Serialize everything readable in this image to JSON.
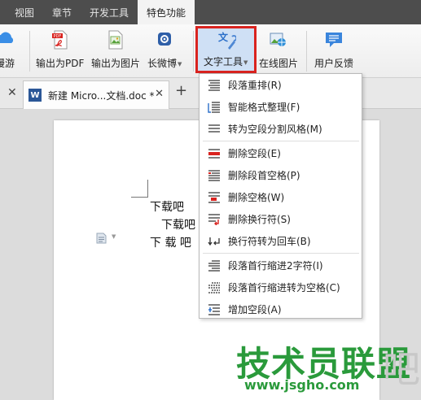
{
  "ribbon": {
    "tabs": [
      "视图",
      "章节",
      "开发工具",
      "特色功能"
    ],
    "active_tab": "特色功能"
  },
  "toolbar": {
    "partial_label": "漫游",
    "export_pdf": "输出为PDF",
    "export_image": "输出为图片",
    "long_weibo": "长微博",
    "text_tools": "文字工具",
    "online_images": "在线图片",
    "feedback": "用户反馈"
  },
  "document_tabs": {
    "title": "新建 Micro...文档.doc *"
  },
  "document": {
    "lines": [
      "下载吧",
      "下载吧",
      "下  载  吧"
    ]
  },
  "menu": {
    "items": [
      {
        "label": "段落重排(R)",
        "icon": "paragraph-reflow-icon"
      },
      {
        "label": "智能格式整理(F)",
        "icon": "smart-format-icon"
      },
      {
        "label": "转为空段分割风格(M)",
        "icon": "blank-split-style-icon"
      },
      {
        "label": "删除空段(E)",
        "icon": "delete-blank-paragraph-icon"
      },
      {
        "label": "删除段首空格(P)",
        "icon": "delete-leading-space-icon"
      },
      {
        "label": "删除空格(W)",
        "icon": "delete-space-icon"
      },
      {
        "label": "删除换行符(S)",
        "icon": "delete-linebreak-icon"
      },
      {
        "label": "换行符转为回车(B)",
        "icon": "linebreak-to-enter-icon"
      },
      {
        "label": "段落首行缩进2字符(I)",
        "icon": "first-line-indent-icon"
      },
      {
        "label": "段落首行缩进转为空格(C)",
        "icon": "indent-to-space-icon"
      },
      {
        "label": "增加空段(A)",
        "icon": "add-blank-paragraph-icon"
      }
    ]
  },
  "watermark": {
    "main": "技术员联盟",
    "url": "www.jsgho.com",
    "trailing": "吧"
  },
  "colors": {
    "ribbon_bg": "#4d4d4d",
    "highlight_border": "#d9231f",
    "watermark_green": "#2a9a3b"
  }
}
